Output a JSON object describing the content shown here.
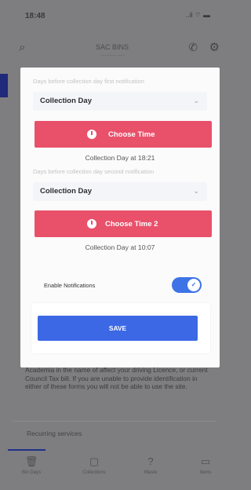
{
  "status_bar": {
    "time": "18:48",
    "system_icons": "..il ⌔ ▬"
  },
  "app_bar": {
    "title": "SAC BINS",
    "subtitle": "............. .....",
    "icons": [
      "search-icon",
      "phone-icon",
      "gear-icon"
    ]
  },
  "background": {
    "text": "Academia in the name of affect your driving Licence, or current Council Tax bill. If you are unable to provide identification in either of these forms you will not be able to use the site.",
    "section_label": "Recurring services",
    "tabs": [
      {
        "label": "Bin Days",
        "icon": "bin-icon"
      },
      {
        "label": "Collections",
        "icon": "calendar-icon"
      },
      {
        "label": "Waste",
        "icon": "question-icon"
      },
      {
        "label": "Items",
        "icon": "chat-icon"
      }
    ]
  },
  "modal": {
    "first": {
      "hint": "Days before collection day first notification",
      "select_value": "Collection Day",
      "button_label": "Choose Time",
      "schedule": "Collection Day at 18:21"
    },
    "second": {
      "hint": "Days before collection day second notification",
      "select_value": "Collection Day",
      "button_label": "Choose Time 2",
      "schedule": "Collection Day at 10:07"
    },
    "notifications_label": "Enable Notifications",
    "notifications_enabled": true,
    "save_label": "SAVE"
  },
  "colors": {
    "accent_red": "#e9506a",
    "accent_blue": "#3c68e5",
    "toggle_blue": "#3d73e6"
  }
}
